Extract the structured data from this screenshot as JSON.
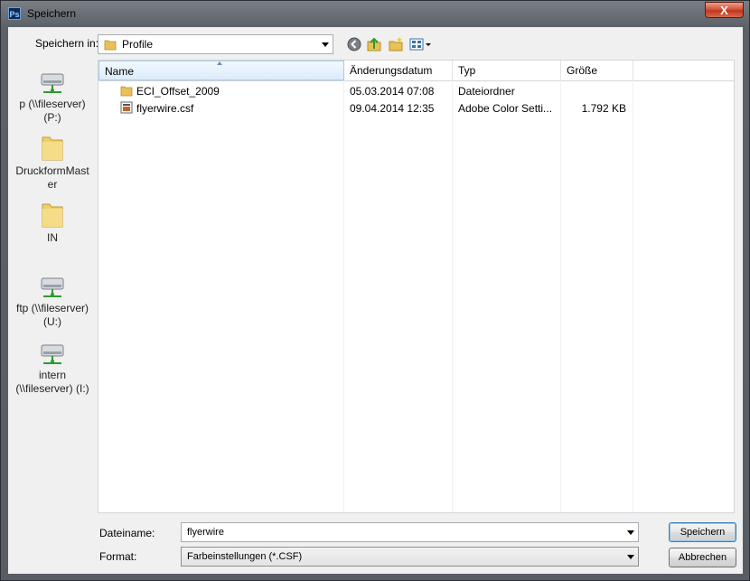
{
  "window": {
    "title": "Speichern",
    "app_icon": "Ps",
    "close_label": "X"
  },
  "save_in": {
    "label": "Speichern in:",
    "value": "Profile"
  },
  "toolbar": {
    "icons": [
      "back-icon",
      "up-folder-icon",
      "new-folder-icon",
      "view-menu-icon"
    ]
  },
  "places": [
    {
      "label": "p (\\\\fileserver)\n(P:)",
      "icon": "network-drive-icon"
    },
    {
      "label": "DruckformMast\ner",
      "icon": "folder-icon"
    },
    {
      "label": "IN",
      "icon": "folder-icon"
    },
    {
      "label": "ftp (\\\\fileserver)\n(U:)",
      "icon": "network-drive-icon"
    },
    {
      "label": "intern\n(\\\\fileserver) (I:)",
      "icon": "network-drive-icon"
    }
  ],
  "columns": [
    "Name",
    "Änderungsdatum",
    "Typ",
    "Größe"
  ],
  "files": [
    {
      "name": "ECI_Offset_2009",
      "date": "05.03.2014 07:08",
      "type": "Dateiordner",
      "size": "",
      "icon": "folder-icon"
    },
    {
      "name": "flyerwire.csf",
      "date": "09.04.2014 12:35",
      "type": "Adobe Color Setti...",
      "size": "1.792 KB",
      "icon": "csf-file-icon"
    }
  ],
  "filename": {
    "label": "Dateiname:",
    "value": "flyerwire"
  },
  "format": {
    "label": "Format:",
    "value": "Farbeinstellungen (*.CSF)"
  },
  "buttons": {
    "save": "Speichern",
    "cancel": "Abbrechen"
  },
  "colors": {
    "accent": "#3c7fb1",
    "selection_header": "#dcecfc"
  }
}
